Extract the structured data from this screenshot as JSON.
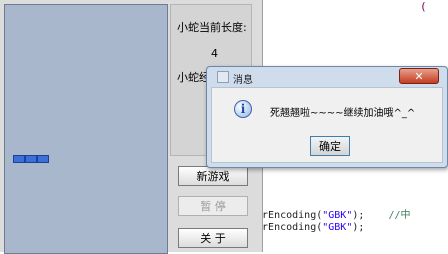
{
  "editor": {
    "fragments": {
      "top_right": "("
    },
    "lines": [
      {
        "pre": "terEncoding(",
        "str": "\"GBK\"",
        "post": ");",
        "comment": "//中"
      },
      {
        "pre": "terEncoding(",
        "str": "\"GBK\"",
        "post": ");",
        "comment": ""
      }
    ]
  },
  "game": {
    "length_label": "小蛇当前长度:",
    "length_value": "4",
    "speed_label": "小蛇经",
    "buttons": {
      "new_game": "新游戏",
      "pause": "暂 停",
      "about": "关 于"
    }
  },
  "dialog": {
    "title": "消息",
    "message": "死翘翘啦~~~~继续加油哦^_^",
    "ok": "确定",
    "close": "✕",
    "info_glyph": "i"
  },
  "colors": {
    "board": "#a9b7cc",
    "snake": "#3d6fd8",
    "dialog_frame": "#cfdcec",
    "close_button": "#c43c23"
  }
}
